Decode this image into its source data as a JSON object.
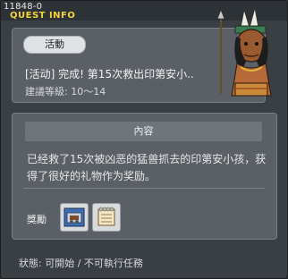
{
  "header": {
    "quest_id": "11848-0",
    "title": "QUEST INFO"
  },
  "summary": {
    "category_tag": "活動",
    "quest_name": "[活动] 完成! 第15次救出印第安小..",
    "level_text": "建議等級: 10～14"
  },
  "content": {
    "header": "內容",
    "description": "已经救了15次被凶恶的猛兽抓去的印第安小孩，获得了很好的礼物作为奖励。",
    "reward_label": "獎勵",
    "rewards": [
      {
        "icon": "equipment-box-icon"
      },
      {
        "icon": "scroll-notebook-icon"
      }
    ]
  },
  "footer": {
    "status_text": "狀態: 可開始 / 不可執行任務"
  },
  "colors": {
    "title_yellow": "#f2d43a",
    "panel_bg": "#5a6066",
    "window_bg": "#3a3f44"
  }
}
